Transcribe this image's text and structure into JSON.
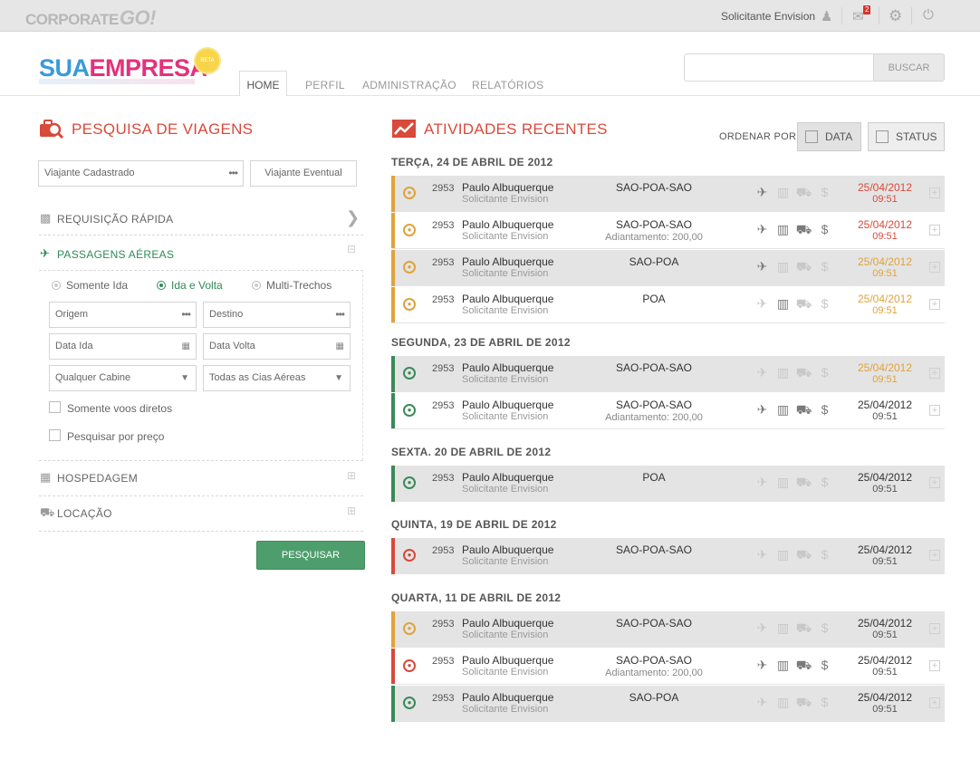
{
  "topbar": {
    "logo_prefix": "CORPORATE",
    "logo_suffix": "GO!",
    "user": "Solicitante Envision",
    "mail_count": "2",
    "icons": [
      "user-icon",
      "mail-icon",
      "gear-icon",
      "power-icon"
    ]
  },
  "brand": {
    "part1": "SUA",
    "part2": "EMPRESA",
    "badge": "BETA"
  },
  "nav": {
    "items": [
      "HOME",
      "PERFIL",
      "ADMINISTRAÇÃO",
      "RELATÓRIOS"
    ],
    "active": "HOME"
  },
  "search": {
    "placeholder": "",
    "button": "BUSCAR"
  },
  "left": {
    "title": "PESQUISA DE VIAGENS",
    "traveler_field": "Viajante Cadastrado",
    "traveler_btn": "Viajante Eventual",
    "quick": "REQUISIÇÃO RÁPIDA",
    "air": "PASSAGENS AÉREAS",
    "trip_types": [
      "Somente Ida",
      "Ida e Volta",
      "Multi-Trechos"
    ],
    "selected_trip": "Ida e Volta",
    "origin": "Origem",
    "dest": "Destino",
    "date_out": "Data Ida",
    "date_back": "Data Volta",
    "cabin": "Qualquer Cabine",
    "airlines": "Todas as Cias Aéreas",
    "direct": "Somente voos diretos",
    "by_price": "Pesquisar por preço",
    "hotel": "HOSPEDAGEM",
    "car": "LOCAÇÃO",
    "submit": "PESQUISAR"
  },
  "right": {
    "title": "ATIVIDADES RECENTES",
    "order_label": "ORDENAR POR:",
    "order_date": "DATA",
    "order_status": "STATUS",
    "days": [
      "TERÇA, 24 DE ABRIL DE 2012",
      "SEGUNDA, 23 DE ABRIL DE 2012",
      "SEXTA. 20 DE ABRIL DE 2012",
      "QUINTA, 19 DE ABRIL DE 2012",
      "QUARTA, 11 DE ABRIL DE 2012"
    ],
    "rows": [
      {
        "num": "2953",
        "name": "Paulo Albuquerque",
        "role": "Solicitante Envision",
        "route": "SAO-POA-SAO",
        "adi": "",
        "date": "25/04/2012",
        "time": "09:51",
        "status_color": "#e0a33a",
        "date_color": "#d84a3a"
      },
      {
        "num": "2953",
        "name": "Paulo Albuquerque",
        "role": "Solicitante Envision",
        "route": "SAO-POA-SAO",
        "adi": "Adiantamento: 200,00",
        "date": "25/04/2012",
        "time": "09:51",
        "status_color": "#e0a33a",
        "date_color": "#d84a3a"
      },
      {
        "num": "2953",
        "name": "Paulo Albuquerque",
        "role": "Solicitante Envision",
        "route": "SAO-POA",
        "adi": "",
        "date": "25/04/2012",
        "time": "09:51",
        "status_color": "#e0a33a",
        "date_color": "#e0a33a"
      },
      {
        "num": "2953",
        "name": "Paulo Albuquerque",
        "role": "Solicitante Envision",
        "route": "POA",
        "adi": "",
        "date": "25/04/2012",
        "time": "09:51",
        "status_color": "#e0a33a",
        "date_color": "#e0a33a"
      },
      {
        "num": "2953",
        "name": "Paulo Albuquerque",
        "role": "Solicitante Envision",
        "route": "SAO-POA-SAO",
        "adi": "",
        "date": "25/04/2012",
        "time": "09:51",
        "status_color": "#3a8a5a",
        "date_color": "#e0a33a"
      },
      {
        "num": "2953",
        "name": "Paulo Albuquerque",
        "role": "Solicitante Envision",
        "route": "SAO-POA-SAO",
        "adi": "Adiantamento: 200,00",
        "date": "25/04/2012",
        "time": "09:51",
        "status_color": "#3a8a5a",
        "date_color": "#333"
      },
      {
        "num": "2953",
        "name": "Paulo Albuquerque",
        "role": "Solicitante Envision",
        "route": "POA",
        "adi": "",
        "date": "25/04/2012",
        "time": "09:51",
        "status_color": "#3a8a5a",
        "date_color": "#333"
      },
      {
        "num": "2953",
        "name": "Paulo Albuquerque",
        "role": "Solicitante Envision",
        "route": "SAO-POA-SAO",
        "adi": "",
        "date": "25/04/2012",
        "time": "09:51",
        "status_color": "#d84a3a",
        "date_color": "#333"
      },
      {
        "num": "2953",
        "name": "Paulo Albuquerque",
        "role": "Solicitante Envision",
        "route": "SAO-POA-SAO",
        "adi": "",
        "date": "25/04/2012",
        "time": "09:51",
        "status_color": "#e0a33a",
        "date_color": "#333"
      },
      {
        "num": "2953",
        "name": "Paulo Albuquerque",
        "role": "Solicitante Envision",
        "route": "SAO-POA-SAO",
        "adi": "Adiantamento: 200,00",
        "date": "25/04/2012",
        "time": "09:51",
        "status_color": "#d84a3a",
        "date_color": "#333"
      },
      {
        "num": "2953",
        "name": "Paulo Albuquerque",
        "role": "Solicitante Envision",
        "route": "SAO-POA",
        "adi": "",
        "date": "25/04/2012",
        "time": "09:51",
        "status_color": "#3a8a5a",
        "date_color": "#333"
      }
    ]
  },
  "colors": {
    "accent_red": "#d84a3a",
    "green": "#4e9e6d",
    "orange": "#e0a33a"
  }
}
